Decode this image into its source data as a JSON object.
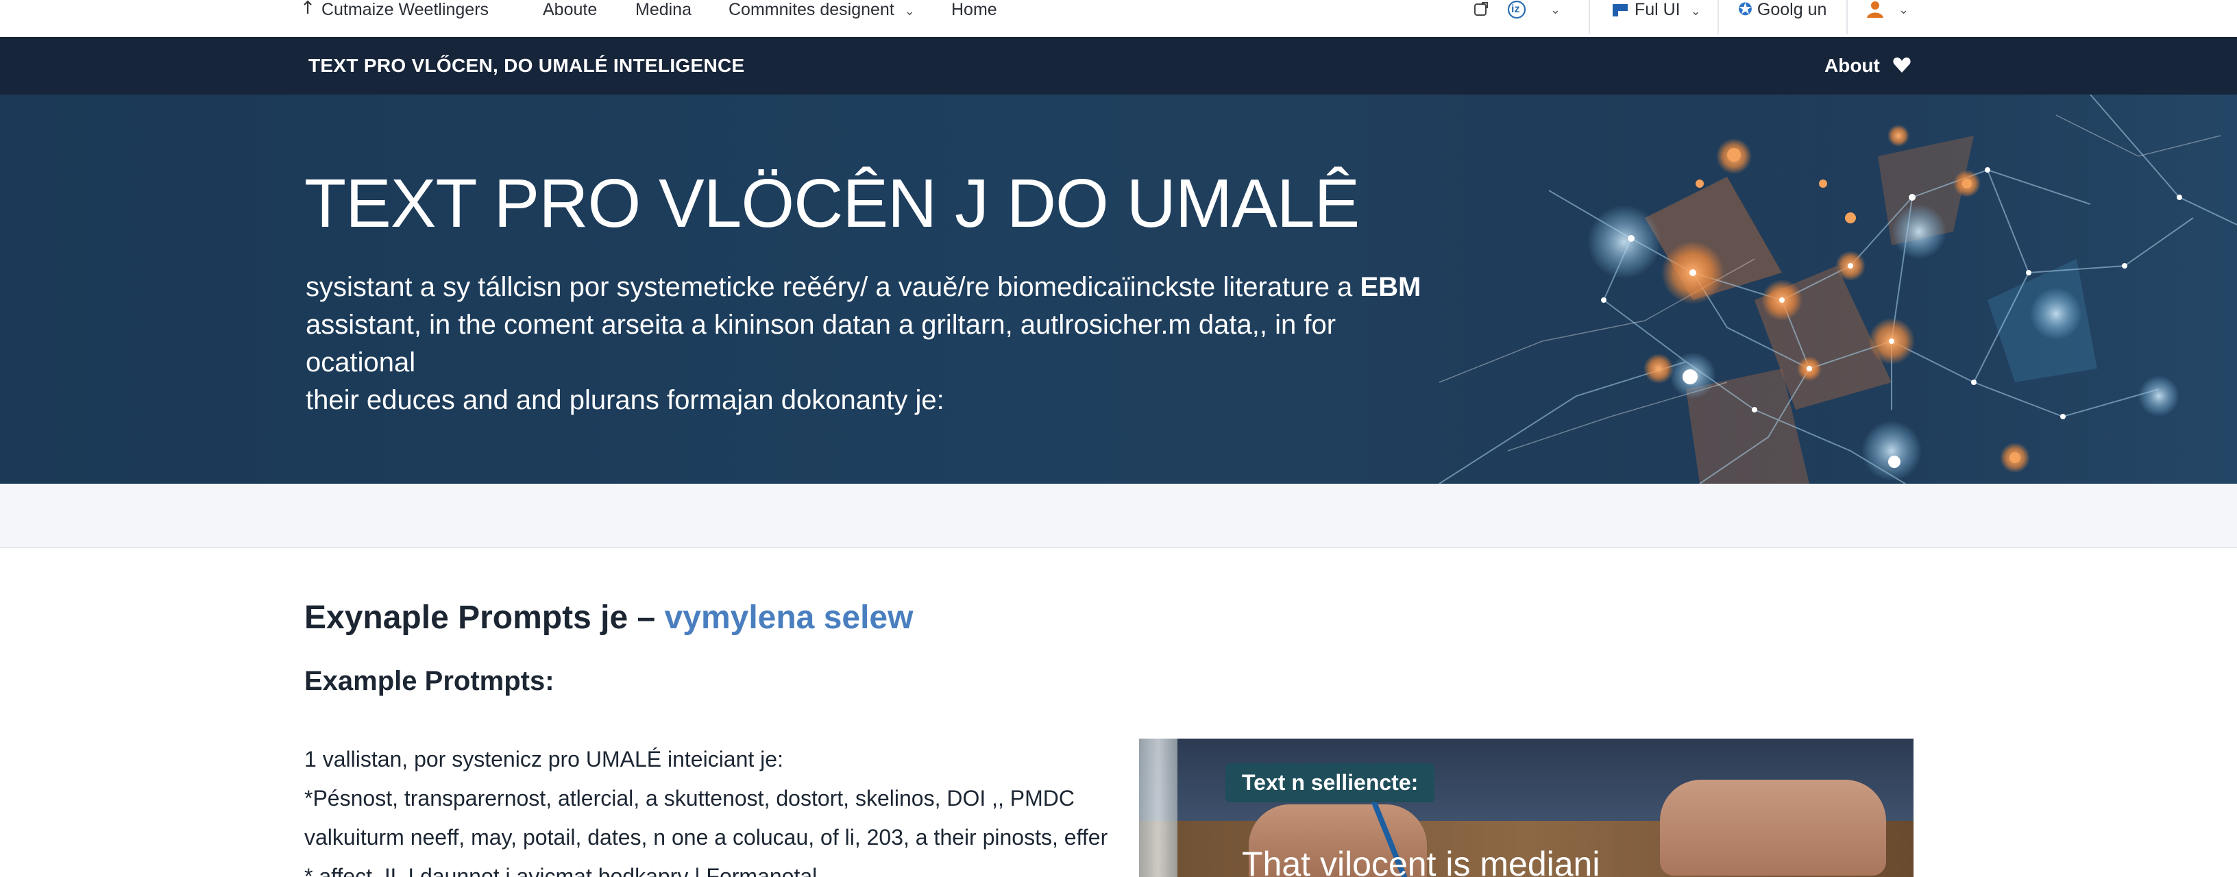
{
  "topnav": {
    "items": [
      {
        "label": "Cutmaize Weetlingers",
        "icon": "arrow-up-icon"
      },
      {
        "label": "Aboute"
      },
      {
        "label": "Medina"
      },
      {
        "label": "Commnites designent"
      },
      {
        "label": "Home"
      }
    ],
    "right": {
      "share_icon": "share-icon",
      "badge_text": "iz",
      "ful_ui_label": "Ful UI",
      "google_label": "Goolg un",
      "user_icon": "user-icon"
    }
  },
  "titlebar": {
    "brand": "TEXT PRO VLŐCEN, DO UMALÉ INTELIGENCE",
    "about_label": "About",
    "about_icon": "heart-icon"
  },
  "hero": {
    "title": "TEXT PRO VLÖCÊN J DO UMALÊ",
    "lead_line1_pre": "sysistant a sy tállcisn por systemeticke reěéry/ a vauě/re biomedicaïinckste literature a",
    "lead_line1_bold": "EBM",
    "lead_line2": "assistant, in the coment arseita a kininson datan a griltarn, autlrosicher.m data,, in for ocational",
    "lead_line3": "their educes and and plurans formajan dokonanty je:"
  },
  "content": {
    "heading_main": "Exynaple Prompts je –",
    "heading_accent": "vymylena selew",
    "subheading": "Example Protmpts:",
    "lines": [
      "1 vallistan, por systenicz pro UMALÉ inteiciant je:",
      "*Pésnost, transparernost, atlercial, a skuttenost, dostort, skelinos, DOI ,, PMDC",
      "valkuiturm neeff, may, potail, dates, n one a colucau, of li, 203, a their pinosts, effer",
      "* affect, IL I daunnot j avicmat bodkapry | Formanotal"
    ]
  },
  "card": {
    "tag": "Text n selliencte:",
    "caption": "That vilocent is mediani"
  },
  "colors": {
    "titlebar_bg": "#17253a",
    "hero_bg": "#1e3f5e",
    "accent": "#4a7fbf",
    "network_orange": "#f08a3c",
    "network_blue": "#7fb4d8"
  }
}
